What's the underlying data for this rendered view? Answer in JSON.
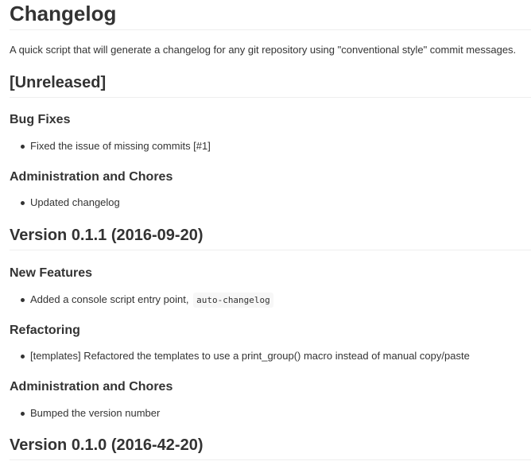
{
  "page": {
    "title": "Changelog",
    "intro": "A quick script that will generate a changelog for any git repository using \"conventional style\" commit messages."
  },
  "unreleased": {
    "heading": "[Unreleased]",
    "bug_fixes": {
      "heading": "Bug Fixes",
      "items": [
        "Fixed the issue of missing commits [#1]"
      ]
    },
    "admin": {
      "heading": "Administration and Chores",
      "items": [
        "Updated changelog"
      ]
    }
  },
  "v011": {
    "heading": "Version 0.1.1 (2016-09-20)",
    "features": {
      "heading": "New Features",
      "item_text": "Added a console script entry point,",
      "item_code": "auto-changelog"
    },
    "refactoring": {
      "heading": "Refactoring",
      "items": [
        "[templates] Refactored the templates to use a print_group() macro instead of manual copy/paste"
      ]
    },
    "admin": {
      "heading": "Administration and Chores",
      "items": [
        "Bumped the version number"
      ]
    }
  },
  "v010": {
    "heading": "Version 0.1.0 (2016-42-20)"
  }
}
